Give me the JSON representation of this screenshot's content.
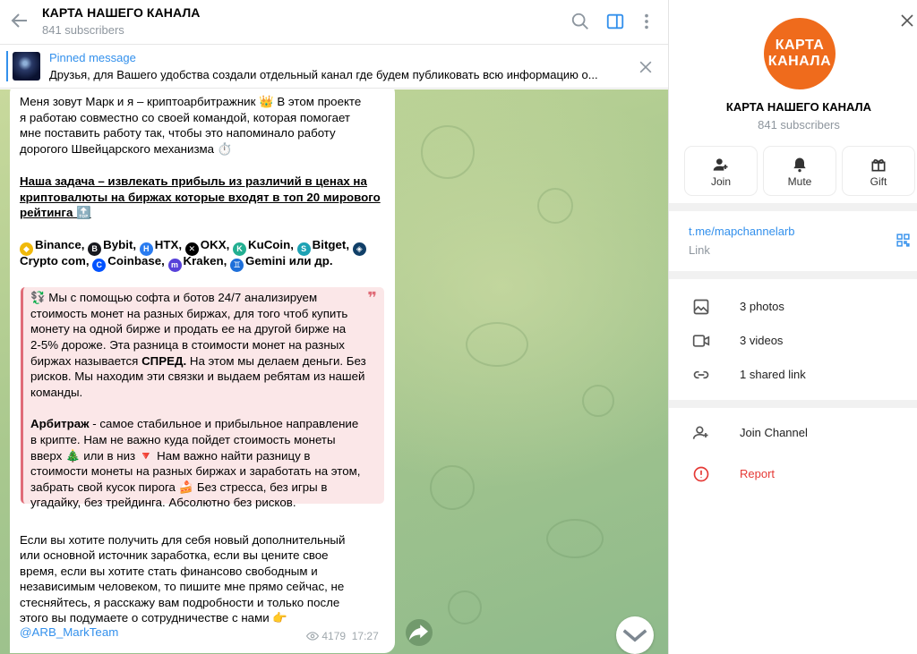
{
  "header": {
    "title": "КАРТА НАШЕГО КАНАЛА",
    "subscribers": "841 subscribers"
  },
  "pinned": {
    "title": "Pinned message",
    "text": "Друзья, для Вашего удобства создали отдельный канал где будем публиковать всю информацию о..."
  },
  "message": {
    "intro_line1": "Меня зовут Марк и я – криптоарбитражник 👑 В этом проекте",
    "intro_line2": "я работаю совместно со своей командой, которая помогает",
    "intro_line3": "мне поставить работу так, чтобы это напоминало работу",
    "intro_line4": "дорогого Швейцарского механизма ⏱️",
    "task_line1": "Наша задача – извлекать прибыль из различий в ценах на",
    "task_line2": "криптовалюты на  биржах которые входят в топ 20 мирового",
    "task_line3": "рейтинга 🔝",
    "exchanges": [
      {
        "name": "Binance,",
        "icon": "binance-icon",
        "color": "#f0b90b"
      },
      {
        "name": "Bybit,",
        "icon": "bybit-icon",
        "color": "#17181e"
      },
      {
        "name": "HTX,",
        "icon": "htx-icon",
        "color": "#2a7cf0"
      },
      {
        "name": "OKX,",
        "icon": "okx-icon",
        "color": "#000000"
      },
      {
        "name": "KuCoin,",
        "icon": "kucoin-icon",
        "color": "#23af91"
      },
      {
        "name": "Bitget,",
        "icon": "bitget-icon",
        "color": "#1da2b4"
      },
      {
        "name": "Crypto com,",
        "icon": "crypto-com-icon",
        "color": "#103f68"
      },
      {
        "name": "Coinbase,",
        "icon": "coinbase-icon",
        "color": "#0052ff"
      },
      {
        "name": "Kraken,",
        "icon": "kraken-icon",
        "color": "#5741d9"
      },
      {
        "name": "Gemini или др.",
        "icon": "gemini-icon",
        "color": "#1e6fd9"
      }
    ],
    "quote": {
      "p1_lines": [
        "💱 Мы с помощью софта и ботов 24/7 анализируем",
        "стоимость монет на разных биржах, для того чтоб купить",
        "монету на одной бирже и продать ее на другой бирже на",
        "2-5% дороже. Эта разница в стоимости монет на разных",
        "биржах называется",
        "СПРЕД.",
        " На этом мы делаем деньги. Без",
        "рисков. Мы находим эти связки и выдаем ребятам из нашей",
        "команды."
      ],
      "p2_bold": "Арбитраж",
      "p2_lines": [
        " - самое стабильное и прибыльное направление",
        "в крипте. Нам не важно куда пойдет стоимость монеты",
        "вверх 🎄  или в низ 🔻  Нам важно найти разницу в",
        "стоимости монеты на разных биржах и заработать на этом,",
        "забрать свой кусок пирога 🍰 Без стресса, без игры в",
        "угадайку, без трейдинга. Абсолютно без рисков."
      ]
    },
    "outro_lines": [
      "Если вы хотите получить для себя новый дополнительный",
      "или основной источник заработка, если вы цените свое",
      "время, если вы хотите стать финансово свободным и",
      "независимым человеком, то пишите мне прямо сейчас, не",
      "стесняйтесь, я расскажу вам подробности и только после",
      "этого вы подумаете о сотрудничестве с нами 👉"
    ],
    "author_link": "@ARB_MarkTeam",
    "views": "4179",
    "time": "17:27"
  },
  "panel": {
    "avatar_text": "КАРТА КАНАЛА",
    "title": "КАРТА НАШЕГО КАНАЛА",
    "subscribers": "841 subscribers",
    "actions": [
      {
        "label": "Join",
        "icon": "add-user-icon"
      },
      {
        "label": "Mute",
        "icon": "bell-icon"
      },
      {
        "label": "Gift",
        "icon": "gift-icon"
      }
    ],
    "link": "t.me/mapchannelarb",
    "link_label": "Link",
    "media": [
      {
        "label": "3 photos",
        "icon": "photo-icon"
      },
      {
        "label": "3 videos",
        "icon": "video-icon"
      },
      {
        "label": "1 shared link",
        "icon": "link-icon"
      }
    ],
    "join_channel": "Join Channel",
    "report": "Report",
    "report_color": "#e53935",
    "accent_color": "#3390ec"
  }
}
